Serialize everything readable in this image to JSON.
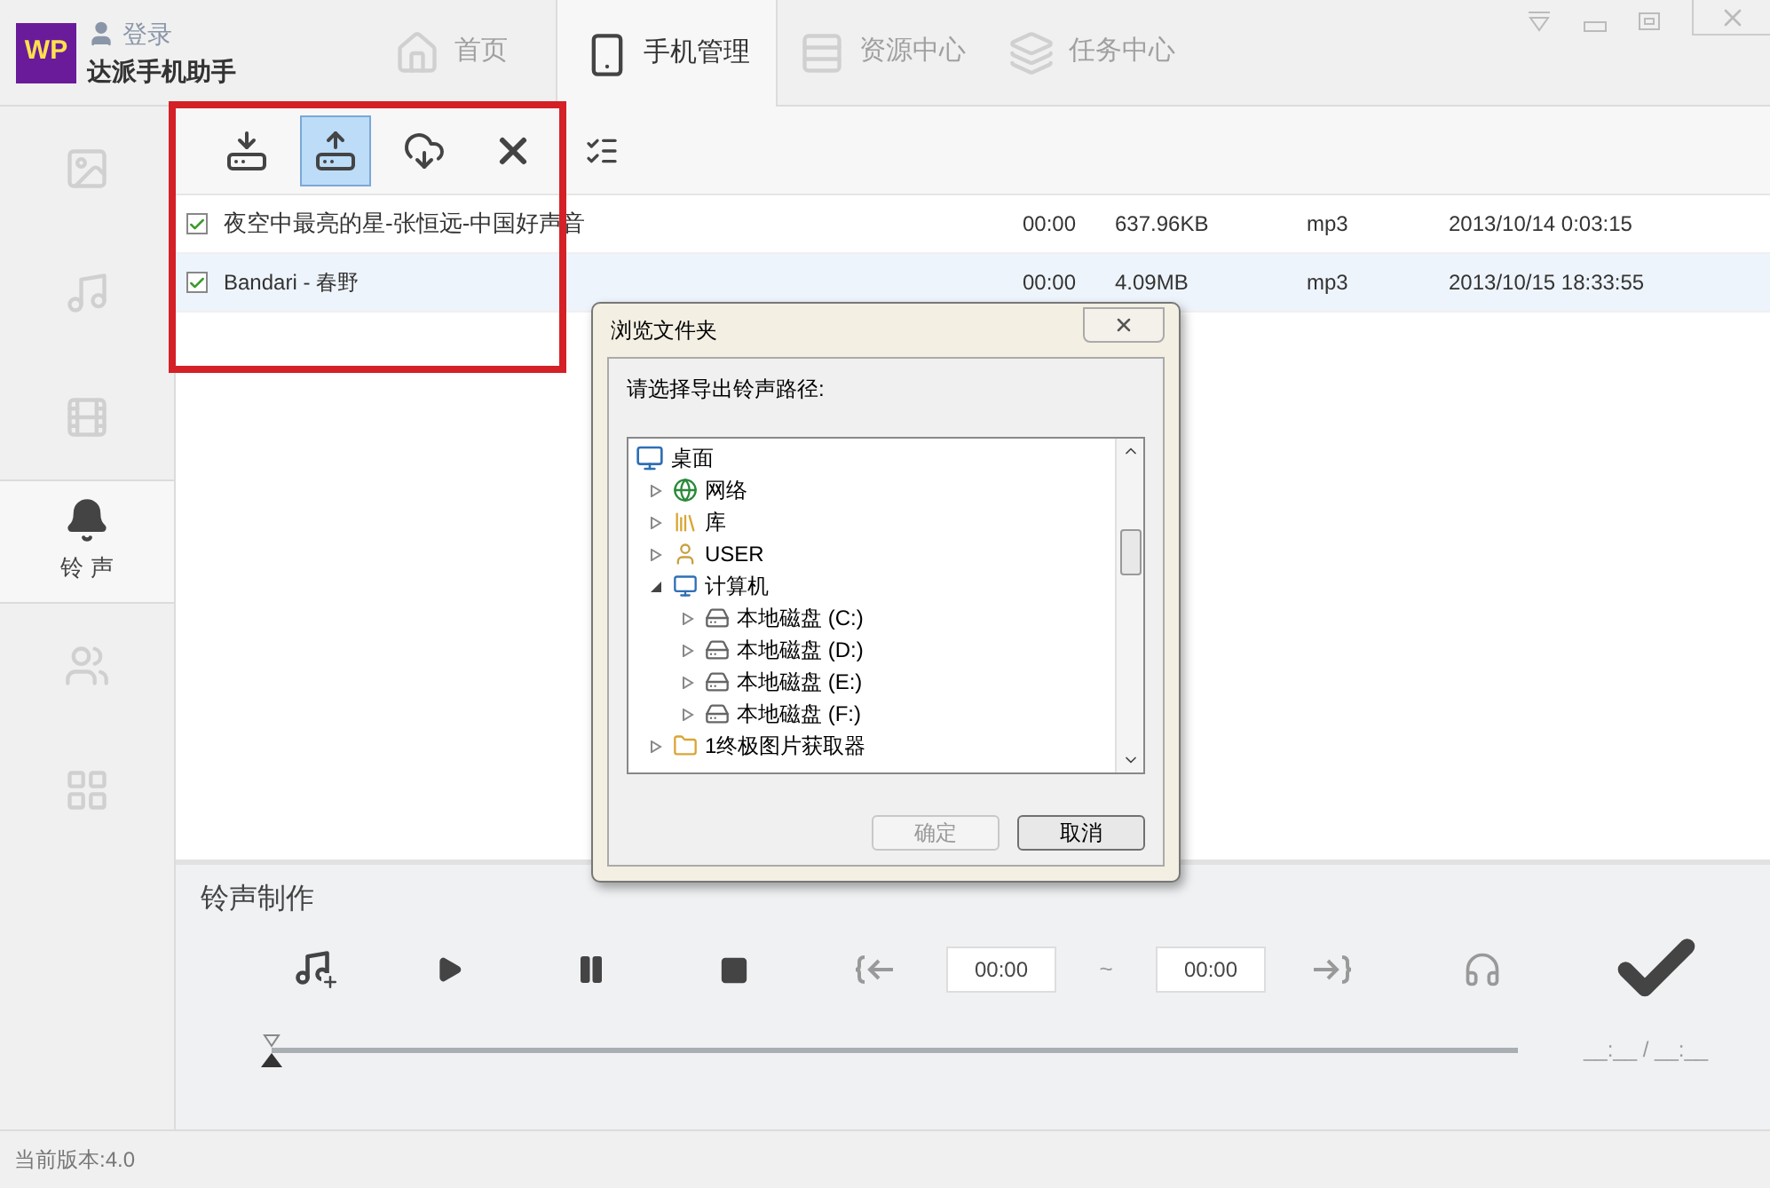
{
  "app": {
    "logo": "WP",
    "login": "登录",
    "name": "达派手机助手"
  },
  "nav_tabs": [
    {
      "label": "首页",
      "selected": false
    },
    {
      "label": "手机管理",
      "selected": true
    },
    {
      "label": "资源中心",
      "selected": false
    },
    {
      "label": "任务中心",
      "selected": false
    }
  ],
  "sidebar": {
    "items": [
      {
        "selected": false
      },
      {
        "selected": false
      },
      {
        "selected": false
      },
      {
        "label": "铃 声",
        "selected": true
      },
      {
        "selected": false
      },
      {
        "selected": false
      }
    ]
  },
  "toolbar": [
    {
      "selected": false
    },
    {
      "selected": true
    },
    {
      "selected": false
    },
    {
      "selected": false
    },
    {
      "selected": false
    }
  ],
  "table": {
    "rows": [
      {
        "checked": true,
        "selected": false,
        "name": "夜空中最亮的星-张恒远-中国好声音",
        "duration": "00:00",
        "size": "637.96KB",
        "type": "mp3",
        "date": "2013/10/14 0:03:15"
      },
      {
        "checked": true,
        "selected": true,
        "name": "Bandari - 春野",
        "duration": "00:00",
        "size": "4.09MB",
        "type": "mp3",
        "date": "2013/10/15 18:33:55"
      }
    ]
  },
  "dialog": {
    "title": "浏览文件夹",
    "prompt": "请选择导出铃声路径:",
    "tree": [
      {
        "label": "桌面",
        "kind": "desktop",
        "children": [
          {
            "label": "网络",
            "kind": "network",
            "expanded": false
          },
          {
            "label": "库",
            "kind": "library",
            "expanded": false
          },
          {
            "label": "USER",
            "kind": "user",
            "expanded": false
          },
          {
            "label": "计算机",
            "kind": "computer",
            "expanded": true,
            "children": [
              {
                "label": "本地磁盘 (C:)",
                "kind": "drive",
                "expanded": false
              },
              {
                "label": "本地磁盘 (D:)",
                "kind": "drive",
                "expanded": false
              },
              {
                "label": "本地磁盘 (E:)",
                "kind": "drive",
                "expanded": false
              },
              {
                "label": "本地磁盘 (F:)",
                "kind": "drive",
                "expanded": false
              }
            ]
          },
          {
            "label": "1终极图片获取器",
            "kind": "folder",
            "expanded": false
          }
        ]
      }
    ],
    "buttons": [
      {
        "label": "确定",
        "disabled": true
      },
      {
        "label": "取消",
        "disabled": false
      }
    ]
  },
  "ringtone_maker": {
    "title": "铃声制作",
    "start_time": "00:00",
    "separator": "~",
    "end_time": "00:00",
    "level": 0,
    "time_reading": "__:__ / __:__"
  },
  "status_bar": {
    "version": "当前版本:4.0"
  }
}
